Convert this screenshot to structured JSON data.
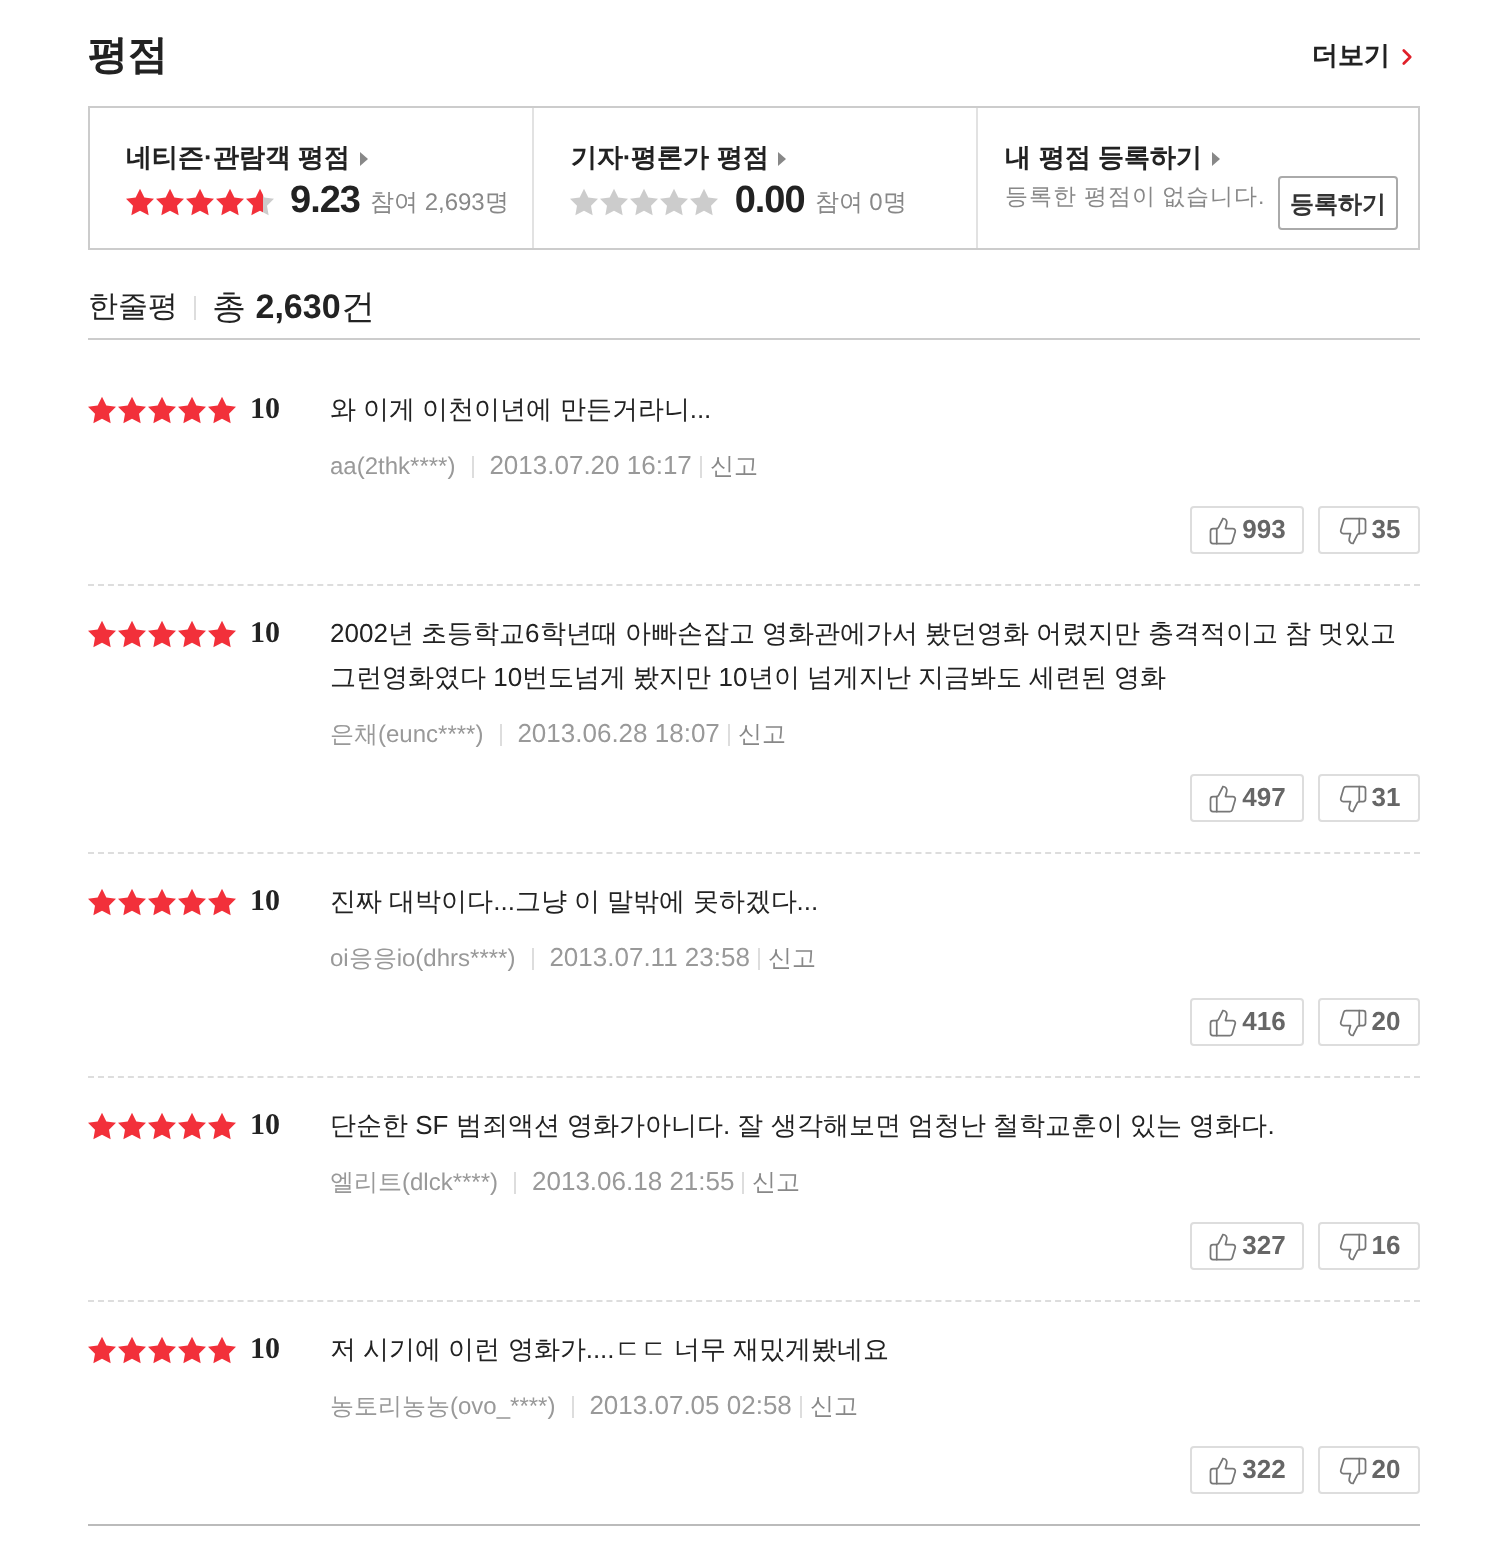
{
  "header": {
    "title": "평점",
    "more_link": "더보기"
  },
  "rating_summary": [
    {
      "kind": "score",
      "label": "네티즌·관람객 평점",
      "stars": 4.6,
      "score": "9.23",
      "participants": "참여 2,693명"
    },
    {
      "kind": "score",
      "label": "기자·평론가 평점",
      "stars": 0,
      "score": "0.00",
      "participants": "참여 0명"
    },
    {
      "kind": "register",
      "label": "내 평점 등록하기",
      "message": "등록한 평점이 없습니다.",
      "button": "등록하기"
    }
  ],
  "reviews_header": {
    "title": "한줄평",
    "total": "총 **2,630**건"
  },
  "reviews": [
    {
      "stars": 5,
      "score": "10",
      "text": "와 이게 이천이년에 만든거라니...",
      "author": "aa(2thk****)",
      "date": "2013.07.20 16:17",
      "report": "신고",
      "likes": "993",
      "dislikes": "35"
    },
    {
      "stars": 5,
      "score": "10",
      "text": "2002년 초등학교6학년때 아빠손잡고 영화관에가서 봤던영화 어렸지만 충격적이고 참 멋있고 그런영화였다 10번도넘게 봤지만 10년이 넘게지난 지금봐도 세련된 영화",
      "author": "은채(eunc****)",
      "date": "2013.06.28 18:07",
      "report": "신고",
      "likes": "497",
      "dislikes": "31"
    },
    {
      "stars": 5,
      "score": "10",
      "text": "진짜 대박이다...그냥 이 말밖에 못하겠다...",
      "author": "oi응응io(dhrs****)",
      "date": "2013.07.11 23:58",
      "report": "신고",
      "likes": "416",
      "dislikes": "20"
    },
    {
      "stars": 5,
      "score": "10",
      "text": "단순한 SF 범죄액션 영화가아니다. 잘 생각해보면 엄청난 철학교훈이 있는 영화다.",
      "author": "엘리트(dlck****)",
      "date": "2013.06.18 21:55",
      "report": "신고",
      "likes": "327",
      "dislikes": "16"
    },
    {
      "stars": 5,
      "score": "10",
      "text": "저 시기에 이런 영화가....ㄷㄷ 너무 재밌게봤네요",
      "author": "농토리농농(ovo_****)",
      "date": "2013.07.05 02:58",
      "report": "신고",
      "likes": "322",
      "dislikes": "20"
    }
  ]
}
